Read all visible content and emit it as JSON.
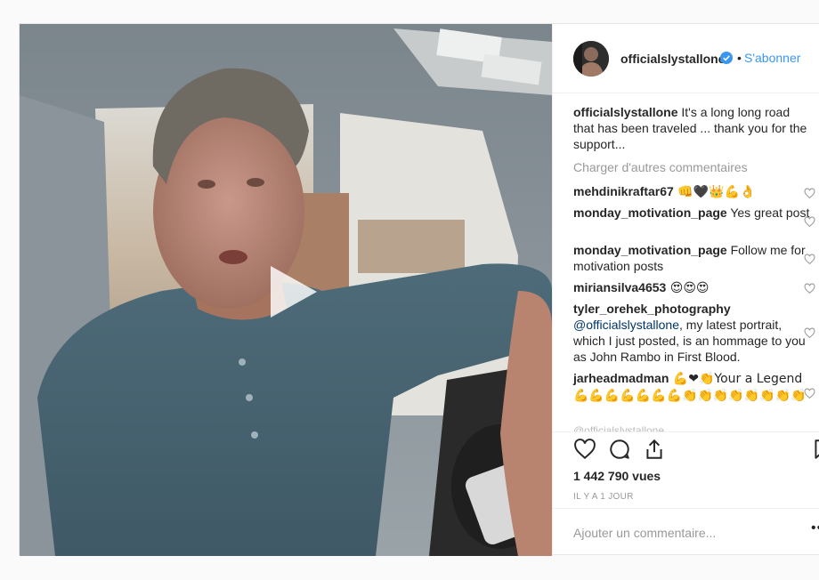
{
  "post": {
    "username": "officialslystallone",
    "follow_label": "S'abonner",
    "dot": "•"
  },
  "caption": {
    "user": "officialslystallone",
    "text": " It's a long long road that has been traveled ... thank you for the support..."
  },
  "load_more_label": "Charger d'autres commentaires",
  "comments": [
    {
      "user": "mehdinikraftar67",
      "text": " 👊🖤👑💪👌"
    },
    {
      "user": "monday_motivation_page",
      "text": " Yes great post"
    },
    {
      "user": "monday_motivation_page",
      "text": " Follow me for motivation posts"
    },
    {
      "user": "miriansilva4653",
      "text": " 😍😍😍"
    },
    {
      "user": "tyler_orehek_photography",
      "mention": " @officialslystallone",
      "text": ", my latest portrait, which I just posted, is an hommage to you as John Rambo in First Blood."
    },
    {
      "user": "jarheadmadman",
      "text": " 💪❤👏Your a Legend 💪💪💪💪💪💪💪👏👏👏👏👏👏👏👏"
    }
  ],
  "partial_comment": "@officialslystallone ...",
  "views": "1 442 790 vues",
  "timestamp": "IL Y A 1 JOUR",
  "add_comment_placeholder": "Ajouter un commentaire...",
  "more_label": "•••",
  "colors": {
    "link_blue": "#3897f0",
    "verified_blue": "#3897f0",
    "muted_gray": "#999999",
    "text": "#262626"
  },
  "icons": [
    "play-icon",
    "verified-icon",
    "heart-icon",
    "comment-icon",
    "share-icon",
    "bookmark-icon"
  ]
}
